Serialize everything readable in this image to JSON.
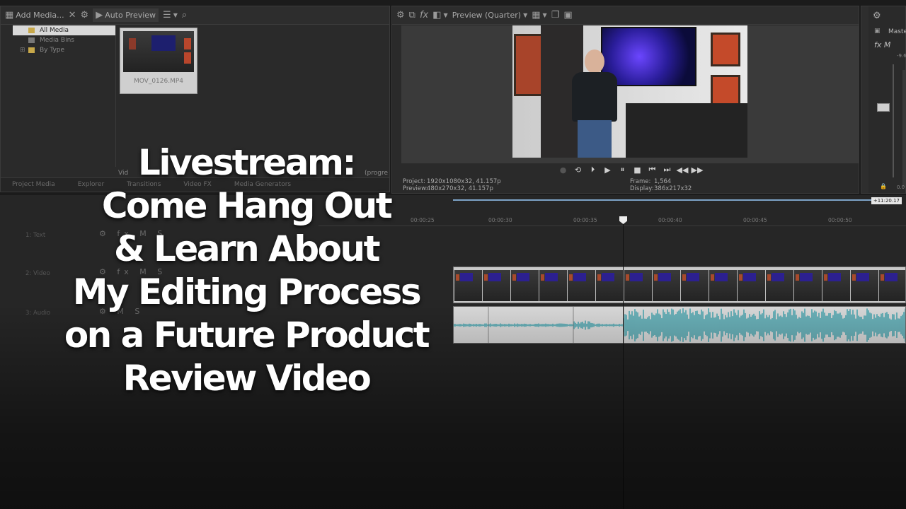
{
  "media_panel": {
    "toolbar": {
      "add_media_label": "Add Media...",
      "auto_preview_label": "Auto Preview"
    },
    "tree": [
      {
        "label": "All Media",
        "selected": true
      },
      {
        "label": "Media Bins",
        "selected": false
      },
      {
        "label": "By Type",
        "selected": false
      }
    ],
    "thumbnail_caption": "MOV_0126.MP4",
    "status_left": "Vid",
    "status_right": "(progre",
    "window_tabs": [
      "Project Media",
      "Explorer",
      "Transitions",
      "Video FX",
      "Media Generators"
    ]
  },
  "preview_panel": {
    "mode_label": "Preview (Quarter)",
    "info": {
      "project_key": "Project:",
      "project_value": "1920x1080x32, 41.157p",
      "preview_key": "Preview:",
      "preview_value": "480x270x32, 41.157p",
      "frame_key": "Frame:",
      "frame_value": "1,564",
      "display_key": "Display:",
      "display_value": "386x217x32"
    }
  },
  "mixer_panel": {
    "master_label": "Maste",
    "fx_label": "fx M",
    "top_db": "-9.6",
    "bottom_db": "0.0"
  },
  "timeline": {
    "time_badge": "+11:20.17",
    "ruler_ticks": [
      "00:00:25",
      "00:00:30",
      "00:00:35",
      "00:00:40",
      "00:00:45",
      "00:00:50"
    ],
    "tracks": [
      {
        "name": "1: Text"
      },
      {
        "name": "2: Video"
      },
      {
        "name": "3: Audio"
      }
    ]
  },
  "overlay": {
    "lines": [
      "Livestream:",
      "Come Hang Out",
      "& Learn About",
      "My Editing Process",
      "on a Future Product",
      "Review Video"
    ]
  },
  "colors": {
    "accent": "#7da3c8",
    "waveform": "#4ea6b0"
  }
}
